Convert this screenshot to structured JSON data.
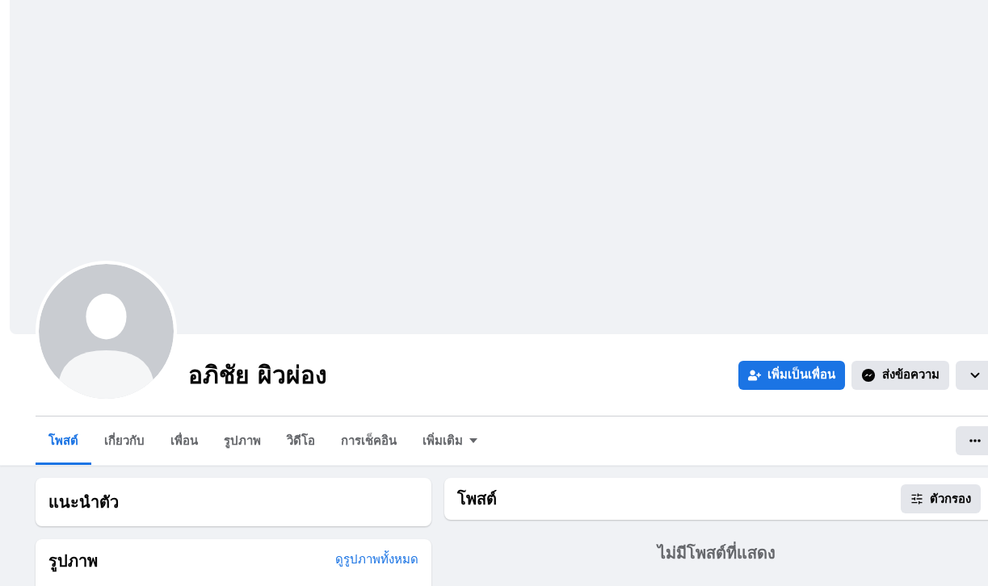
{
  "profile": {
    "name": "อภิชัย ผิวผ่อง",
    "actions": [
      {
        "kind": "add_friend",
        "label": "เพิ่มเป็นเพื่อน"
      },
      {
        "kind": "message",
        "label": "ส่งข้อความ"
      },
      {
        "kind": "dropdown"
      }
    ]
  },
  "tabs": [
    {
      "label": "โพสต์",
      "selected": true
    },
    {
      "label": "เกี่ยวกับ",
      "selected": false
    },
    {
      "label": "เพื่อน",
      "selected": false
    },
    {
      "label": "รูปภาพ",
      "selected": false
    },
    {
      "label": "วิดีโอ",
      "selected": false
    },
    {
      "label": "การเช็คอิน",
      "selected": false
    },
    {
      "label": "เพิ่มเติม",
      "selected": false,
      "kind": "menu"
    }
  ],
  "intro": {
    "title": "แนะนำตัว"
  },
  "photos": {
    "title": "รูปภาพ",
    "link": "ดูรูปภาพทั้งหมด"
  },
  "posts": {
    "title": "โพสต์",
    "filter": "ตัวกรอง",
    "empty": "ไม่มีโพสต์ที่แสดง"
  }
}
